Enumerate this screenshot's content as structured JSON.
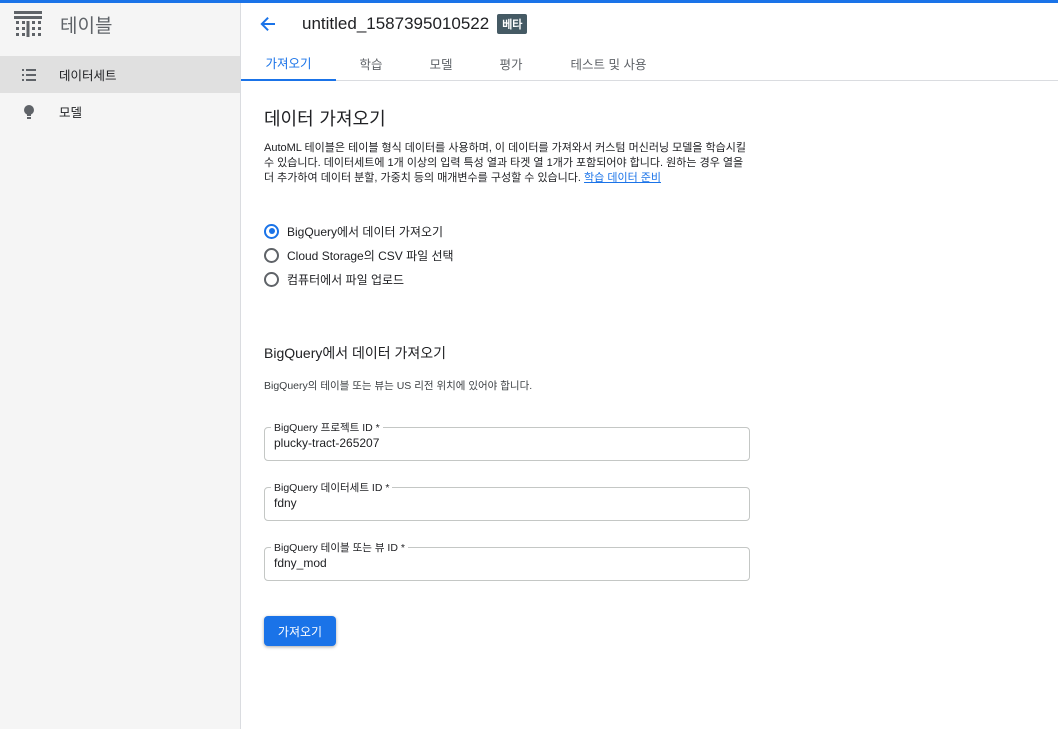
{
  "sidebar": {
    "title": "테이블",
    "items": [
      {
        "label": "데이터세트",
        "icon": "list-icon",
        "active": true
      },
      {
        "label": "모델",
        "icon": "lightbulb-icon",
        "active": false
      }
    ]
  },
  "header": {
    "title": "untitled_1587395010522",
    "badge": "베타"
  },
  "tabs": [
    {
      "label": "가져오기",
      "active": true
    },
    {
      "label": "학습",
      "active": false
    },
    {
      "label": "모델",
      "active": false
    },
    {
      "label": "평가",
      "active": false
    },
    {
      "label": "테스트 및 사용",
      "active": false
    }
  ],
  "main": {
    "heading": "데이터 가져오기",
    "description": "AutoML 테이블은 테이블 형식 데이터를 사용하며, 이 데이터를 가져와서 커스텀 머신러닝 모델을 학습시킬 수 있습니다. 데이터세트에 1개 이상의 입력 특성 열과 타겟 열 1개가 포함되어야 합니다. 원하는 경우 열을 더 추가하여 데이터 분할, 가중치 등의 매개변수를 구성할 수 있습니다.",
    "description_link": "학습 데이터 준비",
    "radios": [
      {
        "label": "BigQuery에서 데이터 가져오기",
        "checked": true
      },
      {
        "label": "Cloud Storage의 CSV 파일 선택",
        "checked": false
      },
      {
        "label": "컴퓨터에서 파일 업로드",
        "checked": false
      }
    ],
    "bq_heading": "BigQuery에서 데이터 가져오기",
    "bq_note": "BigQuery의 테이블 또는 뷰는 US 리전 위치에 있어야 합니다.",
    "fields": [
      {
        "label": "BigQuery 프로젝트 ID *",
        "value": "plucky-tract-265207"
      },
      {
        "label": "BigQuery 데이터세트 ID *",
        "value": "fdny"
      },
      {
        "label": "BigQuery 테이블 또는 뷰 ID *",
        "value": "fdny_mod"
      }
    ],
    "import_button": "가져오기"
  },
  "colors": {
    "accent": "#1a73e8",
    "badge": "#455a64",
    "sidebar_bg": "#f5f5f5",
    "sidebar_active": "#e0e0e0"
  }
}
